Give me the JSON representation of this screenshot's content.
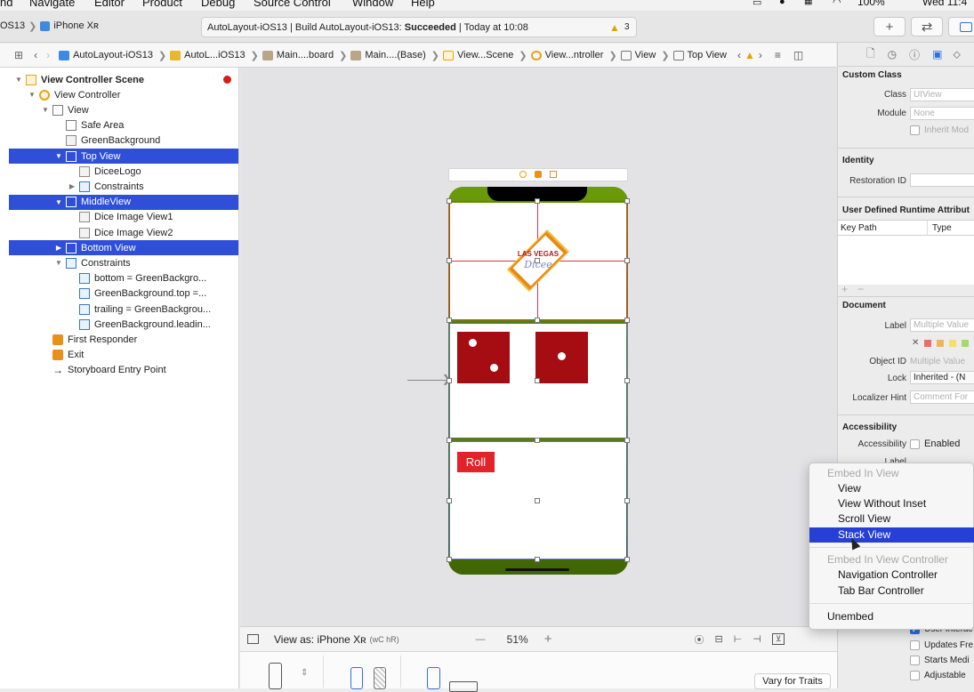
{
  "menubar": [
    "nd",
    "Navigate",
    "Editor",
    "Product",
    "Debug",
    "Source Control",
    "Window",
    "Help"
  ],
  "menubar_right": {
    "battery": "100%",
    "clock": "Wed 11:4"
  },
  "toolbar": {
    "scheme": "OS13",
    "device": "iPhone Xʀ",
    "status_prefix": "AutoLayout-iOS13 | Build AutoLayout-iOS13: ",
    "status_bold": "Succeeded",
    "status_suffix": " | Today at 10:08",
    "warnings": "3",
    "plus": "+",
    "swap": "⇄"
  },
  "jumpbar": [
    "AutoLayout-iOS13",
    "AutoL...iOS13",
    "Main....board",
    "Main....(Base)",
    "View...Scene",
    "View...ntroller",
    "View",
    "Top View"
  ],
  "outline": [
    {
      "label": "View Controller Scene",
      "icon": "scene-icon",
      "indent": 0,
      "tri": "▼",
      "sel": false,
      "bold": true
    },
    {
      "label": "View Controller",
      "icon": "view-controller-icon",
      "indent": 1,
      "tri": "▼",
      "sel": false
    },
    {
      "label": "View",
      "icon": "view-icon",
      "indent": 2,
      "tri": "▼",
      "sel": false
    },
    {
      "label": "Safe Area",
      "icon": "safe-area-icon",
      "indent": 3,
      "tri": "",
      "sel": false
    },
    {
      "label": "GreenBackground",
      "icon": "image-view-icon",
      "indent": 3,
      "tri": "",
      "sel": false
    },
    {
      "label": "Top View",
      "icon": "view-icon",
      "indent": 3,
      "tri": "▼",
      "sel": true
    },
    {
      "label": "DiceeLogo",
      "icon": "image-view-icon",
      "indent": 4,
      "tri": "",
      "sel": false
    },
    {
      "label": "Constraints",
      "icon": "constraints-icon",
      "indent": 4,
      "tri": "▶",
      "sel": false
    },
    {
      "label": "MiddleView",
      "icon": "view-icon",
      "indent": 3,
      "tri": "▼",
      "sel": true
    },
    {
      "label": "Dice Image View1",
      "icon": "image-view-icon",
      "indent": 4,
      "tri": "",
      "sel": false
    },
    {
      "label": "Dice Image View2",
      "icon": "image-view-icon",
      "indent": 4,
      "tri": "",
      "sel": false
    },
    {
      "label": "Bottom View",
      "icon": "view-icon",
      "indent": 3,
      "tri": "▶",
      "sel": true
    },
    {
      "label": "Constraints",
      "icon": "constraints-icon",
      "indent": 3,
      "tri": "▼",
      "sel": false
    },
    {
      "label": "bottom = GreenBackgro...",
      "icon": "constraint-icon",
      "indent": 4,
      "tri": "",
      "sel": false
    },
    {
      "label": "GreenBackground.top =...",
      "icon": "constraint-icon",
      "indent": 4,
      "tri": "",
      "sel": false
    },
    {
      "label": "trailing = GreenBackgrou...",
      "icon": "constraint-icon",
      "indent": 4,
      "tri": "",
      "sel": false
    },
    {
      "label": "GreenBackground.leadin...",
      "icon": "constraint-icon",
      "indent": 4,
      "tri": "",
      "sel": false
    },
    {
      "label": "First Responder",
      "icon": "first-responder-icon",
      "indent": 2,
      "tri": "",
      "sel": false
    },
    {
      "label": "Exit",
      "icon": "exit-icon",
      "indent": 2,
      "tri": "",
      "sel": false
    },
    {
      "label": "Storyboard Entry Point",
      "icon": "entry-arrow-icon",
      "indent": 2,
      "tri": "",
      "sel": false
    }
  ],
  "canvas": {
    "logo_line1": "LAS VEGAS",
    "logo_line2": "Dicee",
    "roll_button": "Roll"
  },
  "bottombar": {
    "view_as": "View as: iPhone Xʀ",
    "traits": "(wC hR)",
    "zoom": "51%",
    "minus": "—",
    "plus": "+"
  },
  "devicebar": {
    "vary": "Vary for Traits"
  },
  "inspector": {
    "custom_class": "Custom Class",
    "class_label": "Class",
    "class_value": "UIView",
    "module_label": "Module",
    "module_value": "None",
    "inherit": "Inherit Mod",
    "identity": "Identity",
    "restoration": "Restoration ID",
    "udra": "User Defined Runtime Attribut",
    "key_path": "Key Path",
    "type": "Type",
    "document": "Document",
    "label_label": "Label",
    "label_value": "Multiple Value",
    "object_id_label": "Object ID",
    "object_id_value": "Multiple Value",
    "lock_label": "Lock",
    "lock_value": "Inherited - (N",
    "localizer_label": "Localizer Hint",
    "localizer_value": "Comment For",
    "accessibility": "Accessibility",
    "acc_label": "Accessibility",
    "acc_enabled": "Enabled",
    "label2": "Label",
    "user_interact": "User Interac",
    "updates": "Updates Fre",
    "starts": "Starts Medi",
    "adjustable": "Adjustable"
  },
  "menu": {
    "header1": "Embed In View",
    "items1": [
      "View",
      "View Without Inset",
      "Scroll View",
      "Stack View"
    ],
    "header2": "Embed In View Controller",
    "items2": [
      "Navigation Controller",
      "Tab Bar Controller"
    ],
    "unembed": "Unembed"
  },
  "colors": {
    "selection": "#2f4fd9",
    "menu_highlight": "#2640d6",
    "dice": "#a50d12",
    "roll": "#e32229",
    "green": "#4f7a05"
  }
}
